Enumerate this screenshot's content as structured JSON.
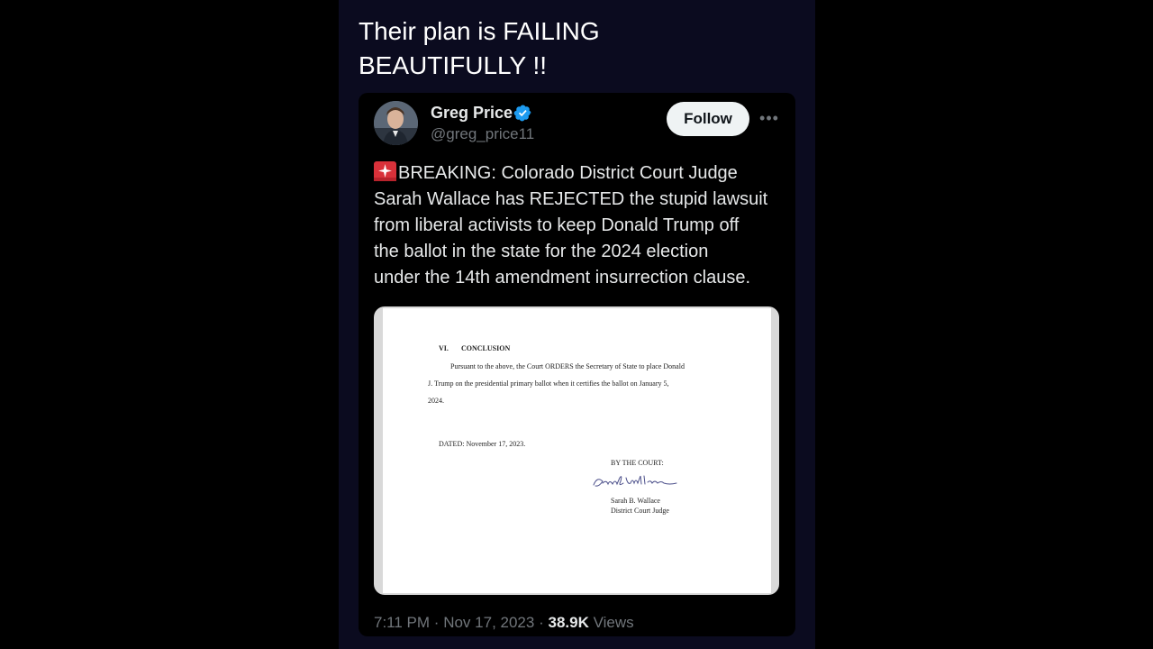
{
  "caption": {
    "line1": "Their plan is FAILING",
    "line2": "BEAUTIFULLY !!"
  },
  "author": {
    "name": "Greg Price",
    "handle": "@greg_price11",
    "verified": true
  },
  "follow_label": "Follow",
  "more_label": "•••",
  "tweet": {
    "lines": [
      "BREAKING: Colorado District Court Judge",
      "Sarah Wallace has REJECTED the stupid lawsuit",
      "from liberal activists to keep Donald Trump off",
      "the ballot in the state for the 2024 election",
      "under the 14th amendment insurrection clause."
    ],
    "emoji": "rotating-light-icon"
  },
  "document": {
    "section": "VI.",
    "section_title": "CONCLUSION",
    "para_line1": "Pursuant to the above, the Court ORDERS the Secretary of State to place Donald",
    "para_line2": "J. Trump on the presidential primary ballot when it certifies the ballot on January 5,",
    "para_line3": "2024.",
    "dated": "DATED: November 17, 2023.",
    "by_the_court": "BY THE COURT:",
    "signature": "Sarah B. Wallace",
    "judge_name": "Sarah B. Wallace",
    "judge_title": "District Court Judge"
  },
  "meta": {
    "time": "7:11 PM",
    "separator": "·",
    "date": "Nov 17, 2023",
    "views_count": "38.9K",
    "views_label": "Views"
  },
  "colors": {
    "background": "#000000",
    "panel": "#0b0b1f",
    "verified_badge": "#1d9bf0",
    "secondary_text": "#71767b",
    "primary_text": "#e7e9ea"
  }
}
